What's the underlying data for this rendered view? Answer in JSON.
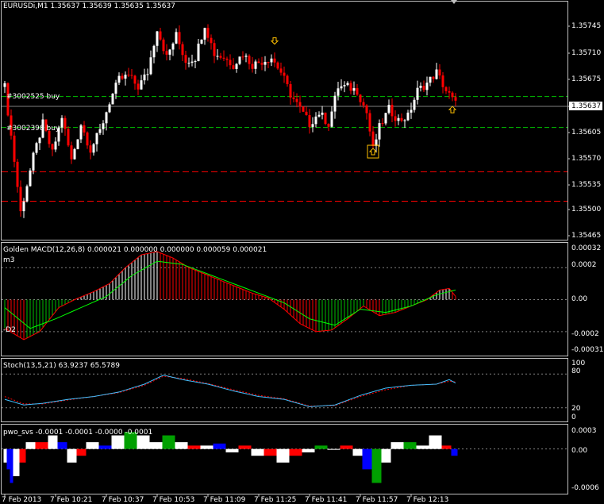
{
  "colors": {
    "background": "#000000",
    "panel_border": "#c0c0c0",
    "bull_candle": "#ffffff",
    "bear_candle": "#ff0000",
    "order_line_green": "#00c000",
    "order_line_red": "#ff0000",
    "grid_dash": "#808080",
    "macd_hist_up": "#ffffff",
    "macd_hist_down": "#ff0000",
    "macd_hist_green": "#00c000",
    "macd_signal": "#00ff00",
    "macd_main": "#ff0000",
    "stoch_main": "#40c0ff",
    "stoch_signal": "#ff0000",
    "pwo_white": "#ffffff",
    "pwo_red": "#ff0000",
    "pwo_blue": "#0000ff",
    "pwo_green": "#00a000",
    "arrow": "#ffc000"
  },
  "main_panel": {
    "title": "EURUSDi,M1  1.35637 1.35639 1.35635 1.35637",
    "price_labels": [
      "1.35745",
      "1.35710",
      "1.35675",
      "1.35640",
      "1.35605",
      "1.35570",
      "1.35535",
      "1.35500",
      "1.35465"
    ],
    "current_price": "1.35637",
    "order_labels": [
      "#3002525 buy",
      "#3002398 buy"
    ]
  },
  "macd_panel": {
    "title": "Golden MACD(12,26,8) 0.000021 0.000000 0.000000 0.000059 0.000021",
    "level_labels": [
      "0.00032",
      "0.0002",
      "0.00",
      "-0.0002",
      "-0.00031"
    ],
    "side_labels": [
      "m3",
      "-D2"
    ]
  },
  "stoch_panel": {
    "title": "Stoch(13,5,21) 63.9237 65.5789",
    "level_labels": [
      "100",
      "80",
      "20",
      "0"
    ]
  },
  "pwo_panel": {
    "title": "pwo_svs -0.0001 -0.0001 -0.0000 -0.0001",
    "level_labels": [
      "0.0003",
      "0.00",
      "-0.0006"
    ]
  },
  "time_axis": {
    "labels": [
      "7 Feb 2013",
      "7 Feb 10:21",
      "7 Feb 10:37",
      "7 Feb 10:53",
      "7 Feb 11:09",
      "7 Feb 11:25",
      "7 Feb 11:41",
      "7 Feb 11:57",
      "7 Feb 12:13"
    ]
  },
  "chart_data": {
    "type": "candlestick",
    "symbol": "EURUSDi",
    "timeframe": "M1",
    "price_range": [
      1.35455,
      1.35765
    ],
    "order_levels": [
      {
        "name": "#3002525 buy",
        "price": 1.35647,
        "style": "green-dash"
      },
      {
        "name": "#3002398 buy",
        "price": 1.35605,
        "style": "green-dash"
      },
      {
        "price": 1.35545,
        "style": "red-dash"
      },
      {
        "price": 1.35505,
        "style": "red-dash"
      }
    ],
    "arrows": [
      {
        "index": 85,
        "price": 1.35718,
        "direction": "down",
        "boxed": false
      },
      {
        "index": 116,
        "price": 1.35568,
        "direction": "up",
        "boxed": true
      },
      {
        "index": 141,
        "price": 1.35625,
        "direction": "up",
        "boxed": false
      }
    ],
    "close_path": [
      [
        0,
        1.3566
      ],
      [
        3,
        1.3556
      ],
      [
        5,
        1.3549
      ],
      [
        9,
        1.35565
      ],
      [
        12,
        1.3561
      ],
      [
        15,
        1.3557
      ],
      [
        18,
        1.3562
      ],
      [
        21,
        1.3556
      ],
      [
        24,
        1.3561
      ],
      [
        27,
        1.35575
      ],
      [
        30,
        1.356
      ],
      [
        33,
        1.3564
      ],
      [
        36,
        1.3567
      ],
      [
        39,
        1.35675
      ],
      [
        42,
        1.3566
      ],
      [
        45,
        1.3568
      ],
      [
        48,
        1.3574
      ],
      [
        51,
        1.357
      ],
      [
        54,
        1.3573
      ],
      [
        57,
        1.35695
      ],
      [
        60,
        1.357
      ],
      [
        63,
        1.35745
      ],
      [
        66,
        1.35705
      ],
      [
        69,
        1.357
      ],
      [
        72,
        1.3569
      ],
      [
        75,
        1.35705
      ],
      [
        78,
        1.3569
      ],
      [
        81,
        1.35695
      ],
      [
        84,
        1.357
      ],
      [
        87,
        1.3568
      ],
      [
        90,
        1.3565
      ],
      [
        93,
        1.3563
      ],
      [
        96,
        1.3561
      ],
      [
        99,
        1.35625
      ],
      [
        102,
        1.3561
      ],
      [
        105,
        1.3566
      ],
      [
        108,
        1.3566
      ],
      [
        111,
        1.35655
      ],
      [
        114,
        1.35625
      ],
      [
        116,
        1.35575
      ],
      [
        118,
        1.35605
      ],
      [
        121,
        1.3563
      ],
      [
        124,
        1.35615
      ],
      [
        127,
        1.3562
      ],
      [
        130,
        1.35655
      ],
      [
        133,
        1.35665
      ],
      [
        136,
        1.3568
      ],
      [
        139,
        1.35655
      ],
      [
        142,
        1.35637
      ]
    ],
    "bar_count": 143,
    "macd": {
      "range": [
        -0.00031,
        0.00032
      ],
      "histogram_path": [
        [
          0,
          -0.00018
        ],
        [
          6,
          -0.00025
        ],
        [
          11,
          -0.0002
        ],
        [
          17,
          -5e-05
        ],
        [
          22,
          0.0
        ],
        [
          28,
          5e-05
        ],
        [
          33,
          0.0001
        ],
        [
          38,
          0.0002
        ],
        [
          43,
          0.00028
        ],
        [
          48,
          0.0003
        ],
        [
          53,
          0.00026
        ],
        [
          58,
          0.0002
        ],
        [
          63,
          0.00016
        ],
        [
          68,
          0.00012
        ],
        [
          73,
          8e-05
        ],
        [
          78,
          4e-05
        ],
        [
          83,
          1e-05
        ],
        [
          88,
          -6e-05
        ],
        [
          93,
          -0.00015
        ],
        [
          98,
          -0.0002
        ],
        [
          103,
          -0.00019
        ],
        [
          108,
          -0.00012
        ],
        [
          113,
          -4e-05
        ],
        [
          118,
          -0.0001
        ],
        [
          123,
          -8e-05
        ],
        [
          128,
          -4e-05
        ],
        [
          133,
          0.0
        ],
        [
          137,
          6e-05
        ],
        [
          140,
          7e-05
        ],
        [
          142,
          2e-05
        ]
      ],
      "signal_path": [
        [
          0,
          -5e-05
        ],
        [
          8,
          -0.00018
        ],
        [
          16,
          -0.00012
        ],
        [
          24,
          -5e-05
        ],
        [
          32,
          2e-05
        ],
        [
          40,
          0.00015
        ],
        [
          48,
          0.00024
        ],
        [
          56,
          0.00022
        ],
        [
          64,
          0.00016
        ],
        [
          72,
          0.0001
        ],
        [
          80,
          4e-05
        ],
        [
          88,
          -2e-05
        ],
        [
          96,
          -0.00012
        ],
        [
          104,
          -0.00016
        ],
        [
          112,
          -6e-05
        ],
        [
          120,
          -8e-05
        ],
        [
          128,
          -4e-05
        ],
        [
          136,
          3e-05
        ],
        [
          142,
          6e-05
        ]
      ]
    },
    "stoch": {
      "range": [
        0,
        100
      ],
      "main_path": [
        [
          0,
          35
        ],
        [
          6,
          25
        ],
        [
          12,
          28
        ],
        [
          20,
          35
        ],
        [
          28,
          40
        ],
        [
          36,
          48
        ],
        [
          44,
          62
        ],
        [
          50,
          78
        ],
        [
          56,
          70
        ],
        [
          64,
          62
        ],
        [
          72,
          50
        ],
        [
          80,
          40
        ],
        [
          88,
          35
        ],
        [
          96,
          22
        ],
        [
          104,
          25
        ],
        [
          112,
          42
        ],
        [
          120,
          55
        ],
        [
          128,
          60
        ],
        [
          136,
          62
        ],
        [
          140,
          70
        ],
        [
          142,
          64
        ]
      ],
      "signal_path": [
        [
          0,
          40
        ],
        [
          6,
          27
        ],
        [
          12,
          27
        ],
        [
          20,
          34
        ],
        [
          28,
          40
        ],
        [
          36,
          47
        ],
        [
          44,
          60
        ],
        [
          50,
          76
        ],
        [
          56,
          72
        ],
        [
          64,
          63
        ],
        [
          72,
          52
        ],
        [
          80,
          42
        ],
        [
          88,
          36
        ],
        [
          96,
          23
        ],
        [
          104,
          24
        ],
        [
          112,
          40
        ],
        [
          120,
          52
        ],
        [
          128,
          60
        ],
        [
          136,
          62
        ],
        [
          140,
          67
        ],
        [
          142,
          66
        ]
      ]
    },
    "pwo": {
      "range": [
        -0.0006,
        0.0003
      ],
      "bars": [
        [
          0,
          -0.0002,
          "white"
        ],
        [
          1,
          -0.0003,
          "blue"
        ],
        [
          2,
          -0.0005,
          "blue"
        ],
        [
          3,
          -0.0004,
          "white"
        ],
        [
          5,
          -0.0002,
          "red"
        ],
        [
          7,
          0.0001,
          "white"
        ],
        [
          10,
          0.0001,
          "red"
        ],
        [
          14,
          0.0002,
          "white"
        ],
        [
          17,
          0.0001,
          "blue"
        ],
        [
          20,
          -0.0002,
          "white"
        ],
        [
          23,
          -0.0001,
          "red"
        ],
        [
          26,
          0.0001,
          "white"
        ],
        [
          30,
          5e-05,
          "blue"
        ],
        [
          34,
          0.0002,
          "white"
        ],
        [
          38,
          0.00025,
          "green"
        ],
        [
          42,
          0.0002,
          "white"
        ],
        [
          46,
          0.0001,
          "white"
        ],
        [
          50,
          0.0002,
          "green"
        ],
        [
          54,
          0.0001,
          "white"
        ],
        [
          58,
          5e-05,
          "red"
        ],
        [
          62,
          5e-05,
          "white"
        ],
        [
          66,
          8e-05,
          "blue"
        ],
        [
          70,
          -5e-05,
          "white"
        ],
        [
          74,
          5e-05,
          "red"
        ],
        [
          78,
          -0.0001,
          "white"
        ],
        [
          82,
          -0.0001,
          "red"
        ],
        [
          86,
          -0.0002,
          "white"
        ],
        [
          90,
          -0.0001,
          "red"
        ],
        [
          94,
          -5e-05,
          "white"
        ],
        [
          98,
          5e-05,
          "green"
        ],
        [
          102,
          0.0,
          "white"
        ],
        [
          106,
          5e-05,
          "red"
        ],
        [
          110,
          -0.0001,
          "white"
        ],
        [
          113,
          -0.0003,
          "blue"
        ],
        [
          116,
          -0.0005,
          "green"
        ],
        [
          119,
          -0.0002,
          "white"
        ],
        [
          122,
          0.0001,
          "white"
        ],
        [
          126,
          0.0001,
          "green"
        ],
        [
          130,
          5e-05,
          "white"
        ],
        [
          134,
          0.0002,
          "white"
        ],
        [
          138,
          5e-05,
          "red"
        ],
        [
          141,
          -0.0001,
          "blue"
        ]
      ]
    },
    "time_label_indices": [
      0,
      16,
      32,
      48,
      64,
      80,
      96,
      112,
      128
    ]
  }
}
